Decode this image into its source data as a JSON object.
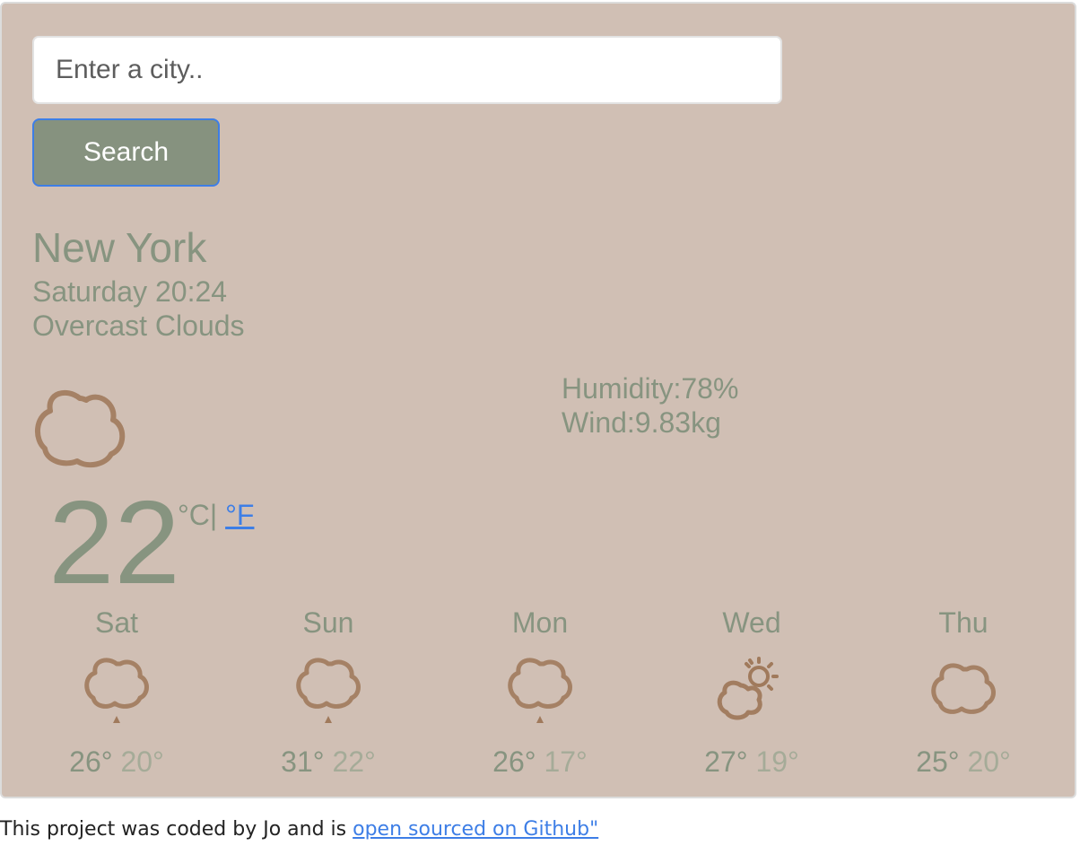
{
  "search": {
    "placeholder": "Enter a city..",
    "button_label": "Search"
  },
  "current": {
    "city": "New York",
    "datetime": "Saturday 20:24",
    "description": "Overcast Clouds",
    "humidity": "Humidity:78%",
    "wind": "Wind:9.83kg",
    "temperature": "22",
    "unit_celsius": "°C|",
    "unit_fahrenheit": "°F",
    "icon": "cloud-icon"
  },
  "forecast": [
    {
      "day": "Sat",
      "high": "26°",
      "low": "20°",
      "icon": "rain-cloud-icon"
    },
    {
      "day": "Sun",
      "high": "31°",
      "low": "22°",
      "icon": "rain-cloud-icon"
    },
    {
      "day": "Mon",
      "high": "26°",
      "low": "17°",
      "icon": "rain-cloud-icon"
    },
    {
      "day": "Wed",
      "high": "27°",
      "low": "19°",
      "icon": "partly-cloudy-icon"
    },
    {
      "day": "Thu",
      "high": "25°",
      "low": "20°",
      "icon": "cloud-icon"
    }
  ],
  "footer": {
    "text": "This project was coded by Jo and is ",
    "link_text": "open sourced on Github\""
  },
  "colors": {
    "card_background": "#d0bfb4",
    "text_sage": "#879480",
    "low_temp": "#a5ab98",
    "icon_brown": "#a07a5c",
    "button": "#86927f",
    "link": "#3d7ee6"
  }
}
